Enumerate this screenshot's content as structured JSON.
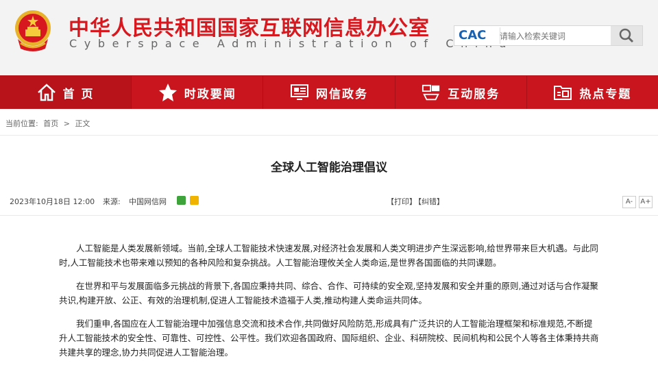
{
  "header": {
    "title": "中华人民共和国国家互联网信息办公室",
    "subtitle": "Cyberspace Administration of China",
    "emblem_icon": "national-emblem-icon",
    "search": {
      "logo_text": "CAC",
      "placeholder": "请输入检索关键词",
      "icon": "search-icon"
    }
  },
  "nav": {
    "items": [
      {
        "label": "首 页",
        "icon": "home-icon"
      },
      {
        "label": "时政要闻",
        "icon": "star-icon"
      },
      {
        "label": "网信政务",
        "icon": "monitor-icon"
      },
      {
        "label": "互动服务",
        "icon": "interaction-icon"
      },
      {
        "label": "热点专题",
        "icon": "folder-icon"
      }
    ]
  },
  "breadcrumb": {
    "prefix": "当前位置:",
    "home": "首页",
    "separator": ">",
    "current": "正文"
  },
  "article": {
    "title": "全球人工智能治理倡议",
    "date": "2023年10月18日 12:00",
    "source_label": "来源:",
    "source": "中国网信网",
    "print": "【打印】",
    "correct": "【纠错】",
    "font_decrease": "A-",
    "font_increase": "A+",
    "paragraphs": [
      "人工智能是人类发展新领域。当前,全球人工智能技术快速发展,对经济社会发展和人类文明进步产生深远影响,给世界带来巨大机遇。与此同时,人工智能技术也带来难以预知的各种风险和复杂挑战。人工智能治理攸关全人类命运,是世界各国面临的共同课题。",
      "在世界和平与发展面临多元挑战的背景下,各国应秉持共同、综合、合作、可持续的安全观,坚持发展和安全并重的原则,通过对话与合作凝聚共识,构建开放、公正、有效的治理机制,促进人工智能技术造福于人类,推动构建人类命运共同体。",
      "我们重申,各国应在人工智能治理中加强信息交流和技术合作,共同做好风险防范,形成具有广泛共识的人工智能治理框架和标准规范,不断提升人工智能技术的安全性、可靠性、可控性、公平性。我们欢迎各国政府、国际组织、企业、科研院校、民间机构和公民个人等各主体秉持共商共建共享的理念,协力共同促进人工智能治理。"
    ]
  },
  "colors": {
    "brand_red": "#c9151e",
    "title_red": "#d7181f",
    "header_bg": "#f3f3f3"
  }
}
